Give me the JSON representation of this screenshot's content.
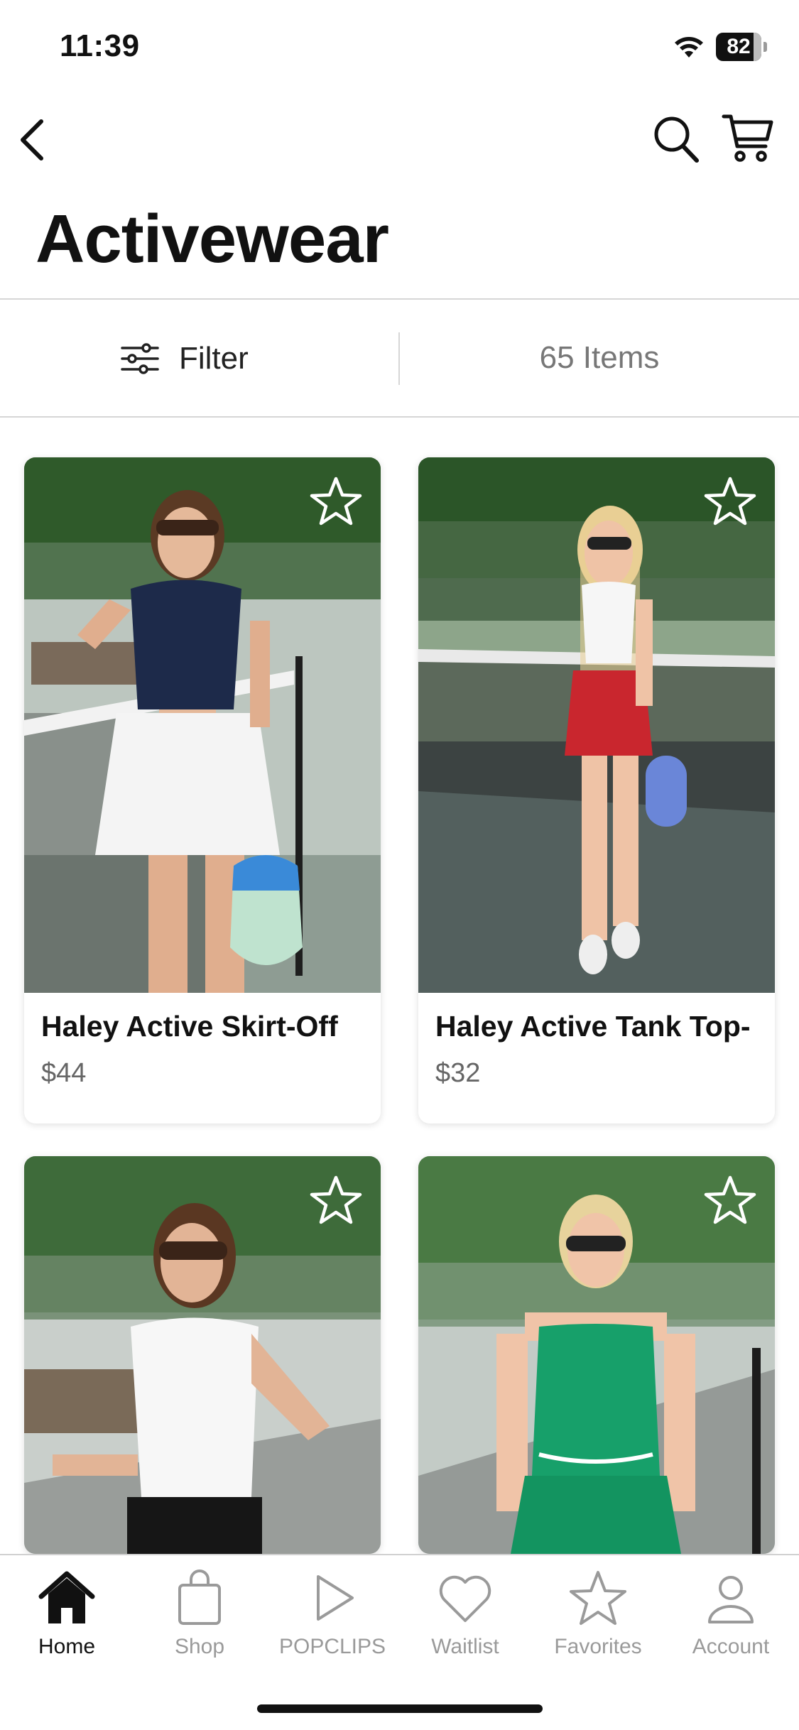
{
  "status_bar": {
    "time": "11:39",
    "battery_level": "82",
    "battery_fraction": 0.82
  },
  "header": {
    "title": "Activewear"
  },
  "filter_bar": {
    "filter_label": "Filter",
    "items_count": "65 Items"
  },
  "products": [
    {
      "name": "Haley Active Skirt-Off",
      "price": "$44"
    },
    {
      "name": "Haley Active Tank Top-",
      "price": "$32"
    },
    {
      "name": "",
      "price": ""
    },
    {
      "name": "",
      "price": ""
    }
  ],
  "tab_bar": {
    "tabs": [
      {
        "label": "Home",
        "icon": "home-icon",
        "active": true
      },
      {
        "label": "Shop",
        "icon": "shopping-bag-icon",
        "active": false
      },
      {
        "label": "POPCLIPS",
        "icon": "play-icon",
        "active": false
      },
      {
        "label": "Waitlist",
        "icon": "heart-icon",
        "active": false
      },
      {
        "label": "Favorites",
        "icon": "star-icon",
        "active": false
      },
      {
        "label": "Account",
        "icon": "person-icon",
        "active": false
      }
    ]
  },
  "colors": {
    "accent": "#111111",
    "inactive": "#9a9a9a",
    "divider": "#d6d6d6"
  }
}
